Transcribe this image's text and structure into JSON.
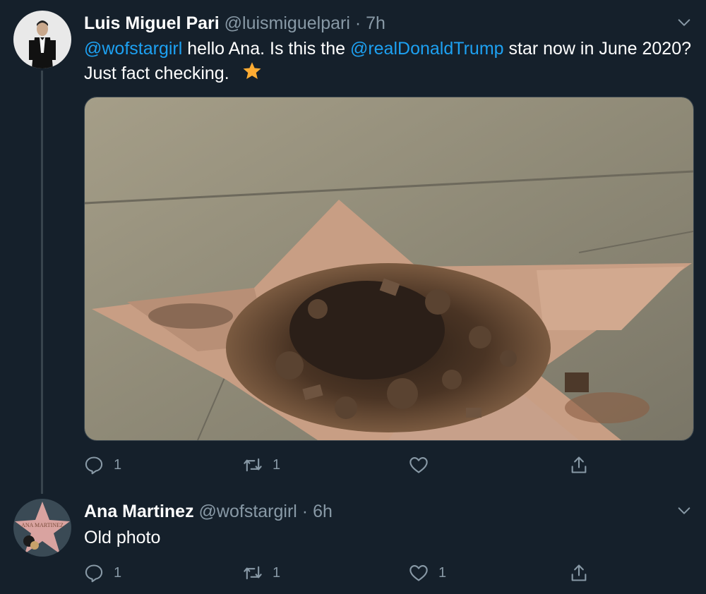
{
  "tweets": [
    {
      "name": "Luis Miguel Pari",
      "handle": "@luismiguelpari",
      "separator": "·",
      "time": "7h",
      "text_parts": {
        "mention1": "@wofstargirl",
        "t1": " hello Ana. Is this the ",
        "mention2": "@realDonaldTrump",
        "t2": " star now in June 2020? Just fact checking."
      },
      "emoji": "star-emoji",
      "media": "photo of destroyed Hollywood Walk of Fame star",
      "actions": {
        "replies": "1",
        "retweets": "1",
        "likes": "",
        "share": ""
      }
    },
    {
      "name": "Ana Martinez",
      "handle": "@wofstargirl",
      "separator": "·",
      "time": "6h",
      "text": "Old photo",
      "avatar_text": "ANA MARTINEZ",
      "actions": {
        "replies": "1",
        "retweets": "1",
        "likes": "1",
        "share": ""
      }
    }
  ],
  "colors": {
    "background": "#15202b",
    "link": "#1da1f2",
    "muted": "#8899a6",
    "divider": "#38444d",
    "emoji_star": "#ffac33"
  }
}
